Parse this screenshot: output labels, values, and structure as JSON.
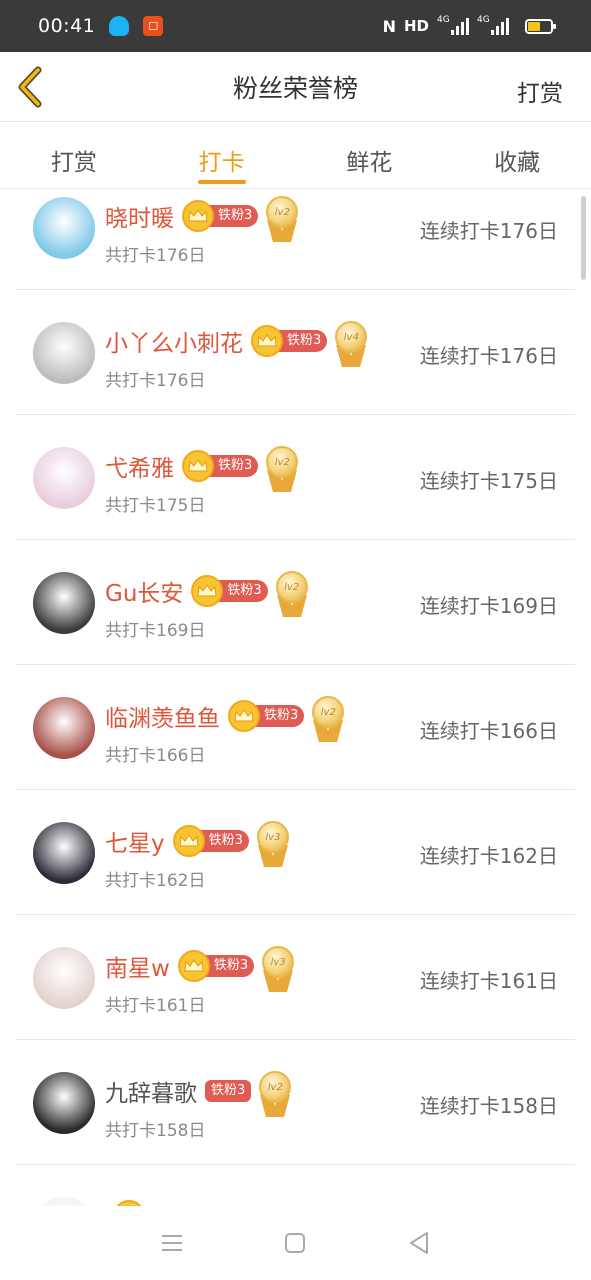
{
  "status_bar": {
    "time": "00:41",
    "hd": "HD",
    "net1": "4G",
    "net2": "4G"
  },
  "header": {
    "title": "粉丝荣誉榜",
    "action": "打赏"
  },
  "tabs": [
    {
      "label": "打赏",
      "active": false
    },
    {
      "label": "打卡",
      "active": true
    },
    {
      "label": "鲜花",
      "active": false
    },
    {
      "label": "收藏",
      "active": false
    }
  ],
  "users": [
    {
      "name": "晓时暖",
      "fan_badge": "铁粉3",
      "crown": true,
      "medal": "lv2",
      "total": "共打卡176日",
      "streak": "连续打卡176日",
      "avatar_color": "#7fc8e8"
    },
    {
      "name": "小丫么小刺花",
      "fan_badge": "铁粉3",
      "crown": true,
      "medal": "lv4",
      "total": "共打卡176日",
      "streak": "连续打卡176日",
      "avatar_color": "#bdbdbd"
    },
    {
      "name": "弋希雅",
      "fan_badge": "铁粉3",
      "crown": true,
      "medal": "lv2",
      "total": "共打卡175日",
      "streak": "连续打卡175日",
      "avatar_color": "#e8cde0"
    },
    {
      "name": "Gu长安",
      "fan_badge": "铁粉3",
      "crown": true,
      "medal": "lv2",
      "total": "共打卡169日",
      "streak": "连续打卡169日",
      "avatar_color": "#3b3b3b"
    },
    {
      "name": "临渊羡鱼鱼",
      "fan_badge": "铁粉3",
      "crown": true,
      "medal": "lv2",
      "total": "共打卡166日",
      "streak": "连续打卡166日",
      "avatar_color": "#a8504a"
    },
    {
      "name": "七星y",
      "fan_badge": "铁粉3",
      "crown": true,
      "medal": "lv3",
      "total": "共打卡162日",
      "streak": "连续打卡162日",
      "avatar_color": "#2c2c3a"
    },
    {
      "name": "南星w",
      "fan_badge": "铁粉3",
      "crown": true,
      "medal": "lv3",
      "total": "共打卡161日",
      "streak": "连续打卡161日",
      "avatar_color": "#e3d2cc"
    },
    {
      "name": "九辞暮歌",
      "fan_badge": "铁粉3",
      "crown": false,
      "medal": "lv2",
      "total": "共打卡158日",
      "streak": "连续打卡158日",
      "avatar_color": "#2a2a2a"
    },
    {
      "name": "",
      "fan_badge": "",
      "crown": true,
      "medal": "",
      "total": "",
      "streak": "",
      "avatar_color": "#f0f0f0"
    }
  ]
}
